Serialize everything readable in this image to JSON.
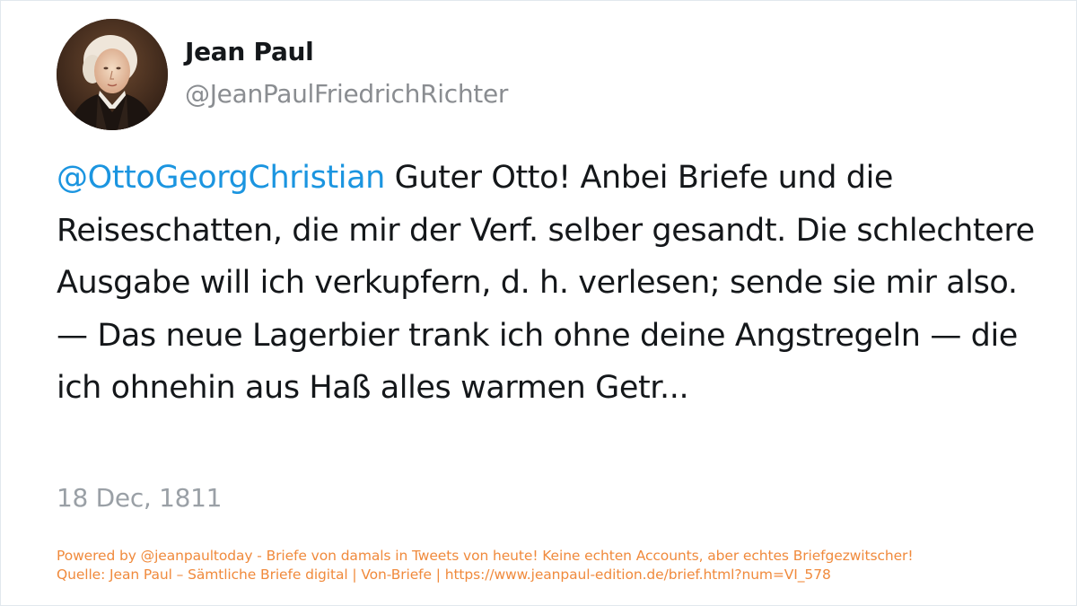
{
  "profile": {
    "display_name": "Jean Paul",
    "handle": "@JeanPaulFriedrichRichter",
    "avatar_icon": "portrait-avatar"
  },
  "tweet": {
    "mention": "@OttoGeorgChristian",
    "text": " Guter Otto! Anbei Briefe und die Reiseschatten, die mir der Verf. selber gesandt. Die schlechtere Ausgabe will ich verkupfern, d. h. verlesen; sende sie mir also. — Das neue Lagerbier trank ich ohne deine Angstregeln — die ich ohnehin aus Haß alles warmen Getr...",
    "timestamp": "18 Dec, 1811"
  },
  "footer": {
    "line1": "Powered by @jeanpaultoday - Briefe von damals in Tweets von heute! Keine echten Accounts, aber echtes Briefgezwitscher!",
    "line2": "Quelle: Jean Paul – Sämtliche Briefe digital | Von-Briefe | https://www.jeanpaul-edition.de/brief.html?num=VI_578"
  },
  "colors": {
    "mention": "#1b95e0",
    "text": "#14171a",
    "muted": "#8a8d91",
    "footer": "#f08a3c"
  }
}
